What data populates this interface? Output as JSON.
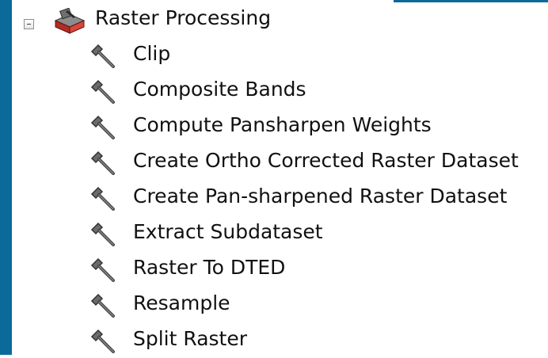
{
  "tree": {
    "root": {
      "label": "Raster Processing",
      "expanded": true,
      "icon": "toolbox-icon"
    },
    "tools": [
      {
        "label": "Clip",
        "icon": "hammer-icon"
      },
      {
        "label": "Composite Bands",
        "icon": "hammer-icon"
      },
      {
        "label": "Compute Pansharpen Weights",
        "icon": "hammer-icon"
      },
      {
        "label": "Create Ortho Corrected Raster Dataset",
        "icon": "hammer-icon"
      },
      {
        "label": "Create Pan-sharpened Raster Dataset",
        "icon": "hammer-icon"
      },
      {
        "label": "Extract Subdataset",
        "icon": "hammer-icon"
      },
      {
        "label": "Raster To DTED",
        "icon": "hammer-icon"
      },
      {
        "label": "Resample",
        "icon": "hammer-icon"
      },
      {
        "label": "Split Raster",
        "icon": "hammer-icon"
      }
    ]
  },
  "colors": {
    "frame": "#0b6a9a",
    "text": "#111111",
    "toolbox_red": "#c0392b"
  }
}
